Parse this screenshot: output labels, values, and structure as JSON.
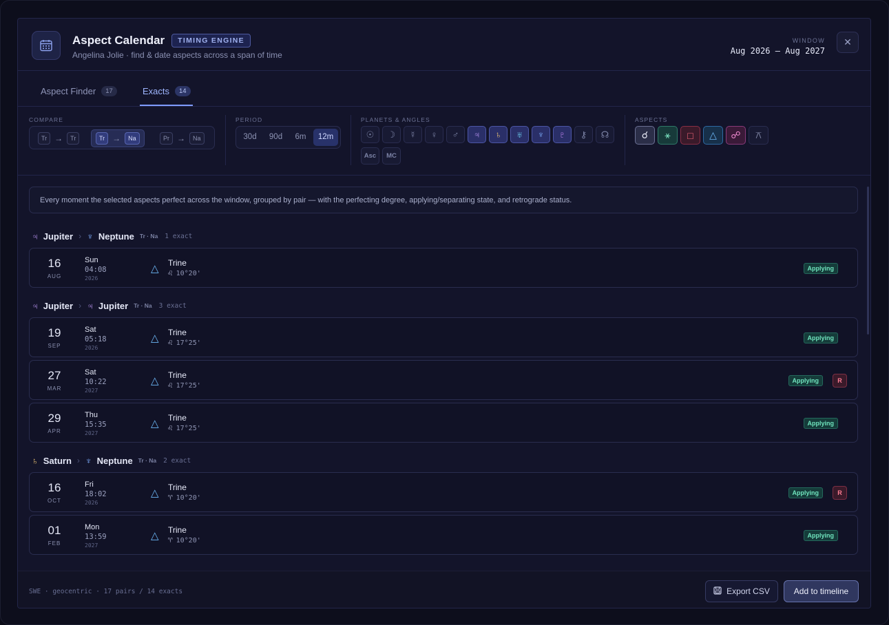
{
  "header": {
    "title": "Aspect Calendar",
    "badge": "TIMING ENGINE",
    "subtitle": "Angelina Jolie · find & date aspects across a span of time",
    "window_label": "WINDOW",
    "window_value": "Aug 2026 – Aug 2027",
    "close_icon": "close-icon"
  },
  "tabs": [
    {
      "label": "Aspect Finder",
      "count": "17",
      "active": false
    },
    {
      "label": "Exacts",
      "count": "14",
      "active": true
    }
  ],
  "filters": {
    "compare_label": "COMPARE",
    "compare": [
      {
        "a": "Tr",
        "b": "Tr",
        "active": false
      },
      {
        "a": "Tr",
        "b": "Na",
        "active": true
      },
      {
        "a": "Pr",
        "b": "Na",
        "active": false
      }
    ],
    "period_label": "PERIOD",
    "periods": [
      {
        "label": "30d",
        "active": false
      },
      {
        "label": "90d",
        "active": false
      },
      {
        "label": "6m",
        "active": false
      },
      {
        "label": "12m",
        "active": true
      }
    ],
    "planets_label": "PLANETS & ANGLES",
    "planets": [
      {
        "glyph": "☉",
        "name": "sun",
        "selected": false
      },
      {
        "glyph": "☽",
        "name": "moon",
        "selected": false
      },
      {
        "glyph": "☿",
        "name": "mercury",
        "selected": false
      },
      {
        "glyph": "♀",
        "name": "venus",
        "selected": false
      },
      {
        "glyph": "♂",
        "name": "mars",
        "selected": false
      },
      {
        "glyph": "♃",
        "name": "jupiter",
        "selected": true,
        "color": "#c59cff"
      },
      {
        "glyph": "♄",
        "name": "saturn",
        "selected": true,
        "color": "#f3c975"
      },
      {
        "glyph": "♅",
        "name": "uranus",
        "selected": true,
        "color": "#6fd3f2"
      },
      {
        "glyph": "♆",
        "name": "neptune",
        "selected": true,
        "color": "#7fb0ff"
      },
      {
        "glyph": "♇",
        "name": "pluto",
        "selected": true,
        "color": "#d08cff"
      },
      {
        "glyph": "⚷",
        "name": "chiron",
        "selected": false
      },
      {
        "glyph": "☊",
        "name": "node",
        "selected": false
      },
      {
        "glyph": "Asc",
        "name": "ascendant",
        "selected": false
      },
      {
        "glyph": "MC",
        "name": "midheaven",
        "selected": false
      }
    ],
    "aspects_label": "ASPECTS",
    "aspects": [
      {
        "glyph": "☌",
        "name": "conjunction",
        "color": "#e6e8f4",
        "bg": "#2b2e48",
        "border": "#6b7094"
      },
      {
        "glyph": "⚹",
        "name": "sextile",
        "color": "#7be5c2",
        "bg": "#173a3a",
        "border": "#2f7a68"
      },
      {
        "glyph": "□",
        "name": "square",
        "color": "#ff6b7e",
        "bg": "#3a1a2a",
        "border": "#8a2f45"
      },
      {
        "glyph": "△",
        "name": "trine",
        "color": "#6cb6f5",
        "bg": "#17304a",
        "border": "#2e6aa3"
      },
      {
        "glyph": "☍",
        "name": "opposition",
        "color": "#f08ad0",
        "bg": "#3a1a38",
        "border": "#8a3a7a"
      },
      {
        "glyph": "⚻",
        "name": "quincunx",
        "color": "#8a90b0",
        "bg": "#181a33",
        "border": "#2a2d50"
      }
    ]
  },
  "note": "Every moment the selected aspects perfect across the window, grouped by pair — with the perfecting degree, applying/separating state, and retrograde status.",
  "groups": [
    {
      "p1": {
        "glyph": "♃",
        "name": "Jupiter",
        "color": "#c59cff"
      },
      "p2": {
        "glyph": "♆",
        "name": "Neptune",
        "color": "#7fb0ff"
      },
      "tag": "Tr · Na",
      "exact": "1 exact",
      "rows": [
        {
          "day": "16",
          "mon": "AUG",
          "dow": "Sun",
          "time": "04:08",
          "year": "2026",
          "aspect": "Trine",
          "sign": "♌",
          "deg": "10°20'",
          "status": "Applying",
          "retro": false
        }
      ]
    },
    {
      "p1": {
        "glyph": "♃",
        "name": "Jupiter",
        "color": "#c59cff"
      },
      "p2": {
        "glyph": "♃",
        "name": "Jupiter",
        "color": "#c59cff"
      },
      "tag": "Tr · Na",
      "exact": "3 exact",
      "rows": [
        {
          "day": "19",
          "mon": "SEP",
          "dow": "Sat",
          "time": "05:18",
          "year": "2026",
          "aspect": "Trine",
          "sign": "♌",
          "deg": "17°25'",
          "status": "Applying",
          "retro": false
        },
        {
          "day": "27",
          "mon": "MAR",
          "dow": "Sat",
          "time": "10:22",
          "year": "2027",
          "aspect": "Trine",
          "sign": "♌",
          "deg": "17°25'",
          "status": "Applying",
          "retro": true
        },
        {
          "day": "29",
          "mon": "APR",
          "dow": "Thu",
          "time": "15:35",
          "year": "2027",
          "aspect": "Trine",
          "sign": "♌",
          "deg": "17°25'",
          "status": "Applying",
          "retro": false
        }
      ]
    },
    {
      "p1": {
        "glyph": "♄",
        "name": "Saturn",
        "color": "#f3c975"
      },
      "p2": {
        "glyph": "♆",
        "name": "Neptune",
        "color": "#7fb0ff"
      },
      "tag": "Tr · Na",
      "exact": "2 exact",
      "rows": [
        {
          "day": "16",
          "mon": "OCT",
          "dow": "Fri",
          "time": "18:02",
          "year": "2026",
          "aspect": "Trine",
          "sign": "♈",
          "deg": "10°20'",
          "status": "Applying",
          "retro": true
        },
        {
          "day": "01",
          "mon": "FEB",
          "dow": "Mon",
          "time": "13:59",
          "year": "2027",
          "aspect": "Trine",
          "sign": "♈",
          "deg": "10°20'",
          "status": "Applying",
          "retro": false
        }
      ]
    }
  ],
  "retro_label": "R",
  "footer": {
    "info": "SWE · geocentric · 17 pairs / 14 exacts",
    "export_label": "Export CSV",
    "add_label": "Add to timeline"
  }
}
